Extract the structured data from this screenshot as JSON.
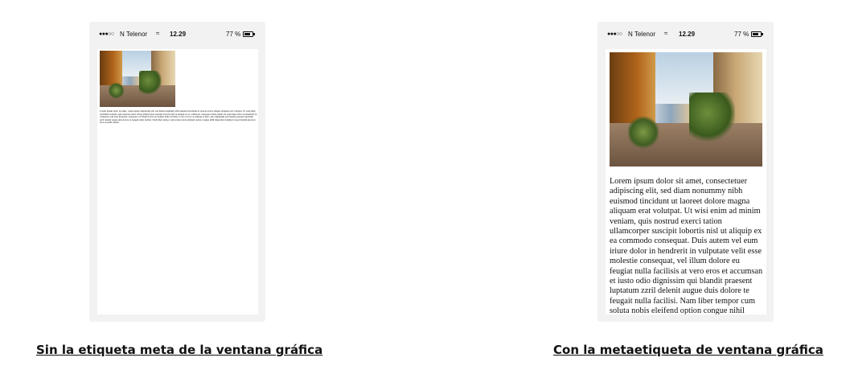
{
  "left_demo": {
    "status": {
      "signal": "●●●○○",
      "carrier": "N Telenor",
      "wifi": "≈",
      "time": "12.29",
      "battery": "77 %"
    },
    "lorem": "Lorem ipsum dolor sit amet, consectetuer adipiscing elit, sed diam nonummy nibh euismod tincidunt ut laoreet dolore magna aliquam erat volutpat. Ut wisi enim ad minim veniam, quis nostrud exerci tation ullamcorper suscipit lobortis nisl ut aliquip ex ea commodo consequat. Duis autem vel eum iriure dolor in hendrerit in vulputate velit esse molestie consequat, vel illum dolore eu feugiat nulla facilisis at vero eros et accumsan et iusto odio dignissim qui blandit praesent luptatum zzril delenit augue duis dolore te feugait nulla facilisi. Nam liber tempor cum soluta nobis eleifend option congue nihil imperdiet doming id quod mazim placerat facer possim assum.",
    "caption": "Sin la etiqueta meta de la ventana gráfica"
  },
  "right_demo": {
    "status": {
      "signal": "●●●○○",
      "carrier": "N Telenor",
      "wifi": "≈",
      "time": "12.29",
      "battery": "77 %"
    },
    "lorem": "Lorem ipsum dolor sit amet, consectetuer adipiscing elit, sed diam nonummy nibh euismod tincidunt ut laoreet dolore magna aliquam erat volutpat. Ut wisi enim ad minim veniam, quis nostrud exerci tation ullamcorper suscipit lobortis nisl ut aliquip ex ea commodo consequat. Duis autem vel eum iriure dolor in hendrerit in vulputate velit esse molestie consequat, vel illum dolore eu feugiat nulla facilisis at vero eros et accumsan et iusto odio dignissim qui blandit praesent luptatum zzril delenit augue duis dolore te feugait nulla facilisi. Nam liber tempor cum soluta nobis eleifend option congue nihil imperdiet doming",
    "caption": "Con la metaetiqueta de ventana gráfica"
  },
  "battery_level": 0.77
}
